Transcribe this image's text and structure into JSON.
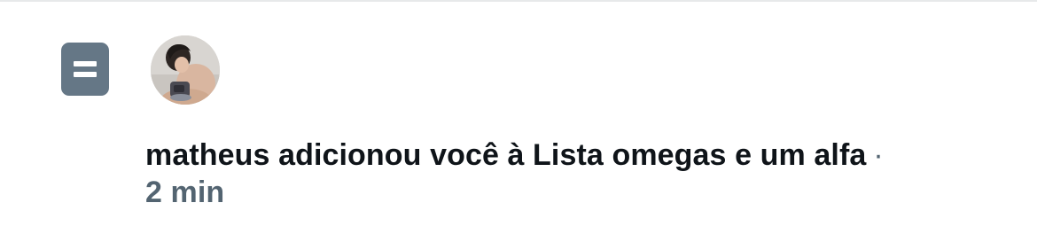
{
  "notification": {
    "icon": "list-icon",
    "avatar_alt": "matheus",
    "message": "matheus adicionou você à Lista omegas e um alfa",
    "separator": "·",
    "time": "2 min"
  }
}
